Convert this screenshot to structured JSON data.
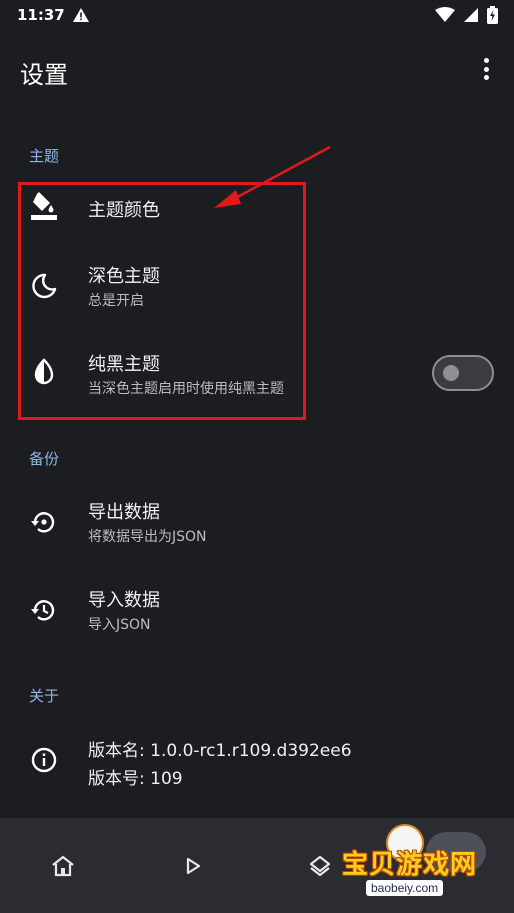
{
  "status_bar": {
    "time": "11:37",
    "icons": [
      "warning-icon",
      "wifi-icon",
      "signal-icon",
      "battery-charging-icon"
    ]
  },
  "app_bar": {
    "title": "设置",
    "overflow_icon": "more-vert-icon"
  },
  "sections": {
    "theme": {
      "header": "主题",
      "items": [
        {
          "icon": "paint-bucket-icon",
          "title": "主题颜色",
          "subtitle": ""
        },
        {
          "icon": "moon-icon",
          "title": "深色主题",
          "subtitle": "总是开启"
        },
        {
          "icon": "contrast-drop-icon",
          "title": "纯黑主题",
          "subtitle": "当深色主题启用时使用纯黑主题",
          "toggle_on": false
        }
      ]
    },
    "backup": {
      "header": "备份",
      "items": [
        {
          "icon": "backup-restore-icon",
          "title": "导出数据",
          "subtitle": "将数据导出为JSON"
        },
        {
          "icon": "history-icon",
          "title": "导入数据",
          "subtitle": "导入JSON"
        }
      ]
    },
    "about": {
      "header": "关于",
      "version_name": "版本名: 1.0.0-rc1.r109.d392ee6",
      "version_code": "版本号: 109"
    }
  },
  "bottom_nav": {
    "items": [
      "home-icon",
      "play-icon",
      "layers-icon",
      "settings-icon"
    ]
  },
  "watermark": {
    "text": "宝贝游戏网",
    "url": "baobeiy.com"
  },
  "colors": {
    "background": "#1c1d21",
    "section_header": "#90b4e6",
    "annotation_red": "#e0191c",
    "nav_bar": "#2b2c31"
  }
}
